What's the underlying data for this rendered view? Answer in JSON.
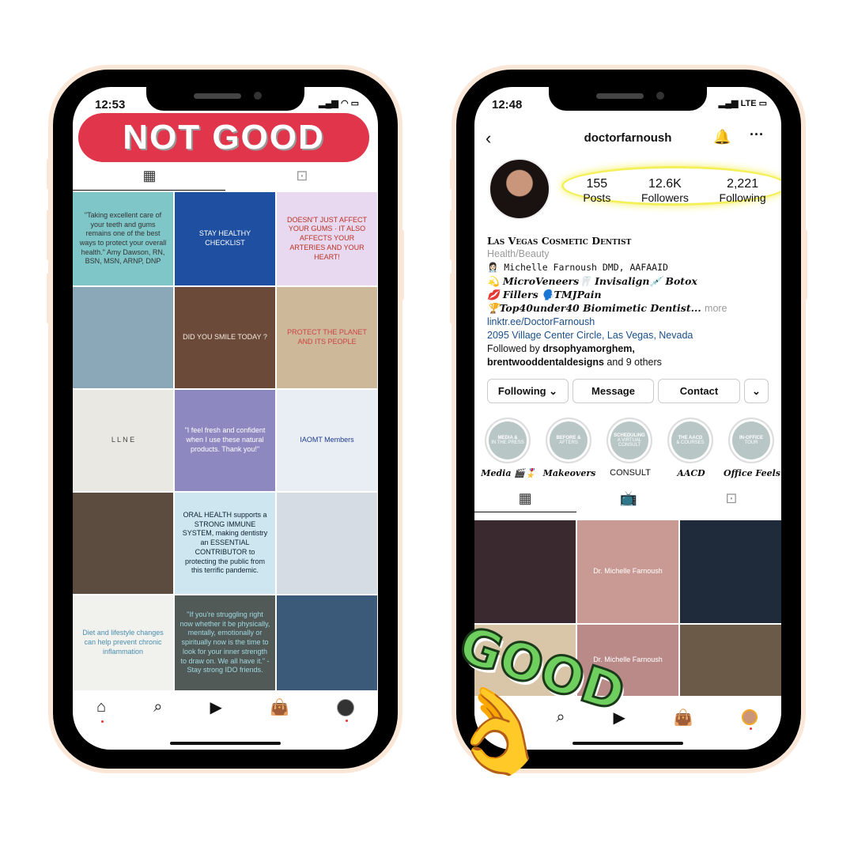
{
  "bad": {
    "time": "12:53",
    "banner": "NOT GOOD",
    "tiles": [
      {
        "text": "\"Taking excellent care of your teeth and gums remains one of the best ways to protect your overall health.\" Amy Dawson, RN, BSN, MSN, ARNP, DNP",
        "bg": "#7fc6c8",
        "fg": "#333"
      },
      {
        "text": "STAY HEALTHY CHECKLIST",
        "bg": "#1e4fa0",
        "fg": "#fff"
      },
      {
        "text": "DOESN'T JUST AFFECT YOUR GUMS · IT ALSO AFFECTS YOUR ARTERIES AND YOUR HEART!",
        "bg": "#e8d8f0",
        "fg": "#b32"
      },
      {
        "text": "",
        "bg": "#8aa8b8",
        "fg": "#fff"
      },
      {
        "text": "DID YOU SMILE TODAY ?",
        "bg": "#6b4a3a",
        "fg": "#f3e9dc"
      },
      {
        "text": "PROTECT THE PLANET AND ITS PEOPLE",
        "bg": "#cdb89a",
        "fg": "#c44"
      },
      {
        "text": "L L N E",
        "bg": "#eae8e2",
        "fg": "#444"
      },
      {
        "text": "\"I feel fresh and confident when I use these natural products. Thank you!\"",
        "bg": "#8d88c0",
        "fg": "#fff"
      },
      {
        "text": "IAOMT Members",
        "bg": "#e9eef5",
        "fg": "#1d3d8a"
      },
      {
        "text": "",
        "bg": "#5b4c3f",
        "fg": "#fff"
      },
      {
        "text": "ORAL HEALTH supports a STRONG IMMUNE SYSTEM, making dentistry an ESSENTIAL CONTRIBUTOR to protecting the public from this terrific pandemic.",
        "bg": "#cde6ef",
        "fg": "#123"
      },
      {
        "text": "",
        "bg": "#d5dce4",
        "fg": "#222"
      },
      {
        "text": "Diet and lifestyle changes can help prevent chronic inflammation",
        "bg": "#f1f1ee",
        "fg": "#4a8fb0"
      },
      {
        "text": "\"If you're struggling right now whether it be physically, mentally, emotionally or spiritually now is the time to look for your inner strength to draw on. We all have it.\" - Stay strong IDO friends.",
        "bg": "#525a58",
        "fg": "#9fd9e0"
      },
      {
        "text": "",
        "bg": "#3b5a7a",
        "fg": "#fff"
      }
    ]
  },
  "good": {
    "time": "12:48",
    "network": "LTE",
    "username": "doctorfarnoush",
    "stats": [
      {
        "value": "155",
        "label": "Posts"
      },
      {
        "value": "12.6K",
        "label": "Followers"
      },
      {
        "value": "2,221",
        "label": "Following"
      }
    ],
    "bio": {
      "name": "Las Vegas Cosmetic Dentist",
      "category": "Health/Beauty",
      "lines": [
        "👩🏻‍⚕️ Michelle Farnoush DMD, AAFAAID",
        "💫 MicroVeneers🦷 Invisalign💉 Botox",
        "💋 Fillers 🗣️TMJPain",
        "🏆Top40under40 Biomimetic Dentist..."
      ],
      "more": "more",
      "link": "linktr.ee/DoctorFarnoush",
      "address": "2095 Village Center Circle, Las Vegas, Nevada",
      "followed_prefix": "Followed by ",
      "followed_1": "drsophyamorghem,",
      "followed_2": "brentwooddentaldesigns",
      "followed_suffix": " and 9 others"
    },
    "buttons": {
      "following": "Following ⌄",
      "message": "Message",
      "contact": "Contact",
      "more": "⌄"
    },
    "highlights": [
      {
        "title": "MEDIA &",
        "sub": "IN THE PRESS",
        "label": "Media 🎬🎖️"
      },
      {
        "title": "BEFORE &",
        "sub": "AFTERS",
        "label": "Makeovers"
      },
      {
        "title": "SCHEDULING",
        "sub": "A VIRTUAL CONSULT",
        "label": "CONSULT"
      },
      {
        "title": "THE AACD",
        "sub": "& COURSES",
        "label": "AACD"
      },
      {
        "title": "IN-OFFICE",
        "sub": "TOUR",
        "label": "Office Feels"
      }
    ],
    "tiles": [
      {
        "text": "",
        "bg": "#3a2a30"
      },
      {
        "text": "Dr. Michelle Farnoush",
        "bg": "#c99a94"
      },
      {
        "text": "",
        "bg": "#1f2a3a"
      },
      {
        "text": "",
        "bg": "#d9c6a8"
      },
      {
        "text": "Dr. Michelle Farnoush",
        "bg": "#b98a88"
      },
      {
        "text": "",
        "bg": "#6b5a48"
      }
    ]
  },
  "sticker": "GOOD",
  "colors": {
    "banner": "#e0354a",
    "highlight_ring": "#f4f05a",
    "link": "#1a4f8b",
    "phone_frame": "#fbe7d8"
  }
}
